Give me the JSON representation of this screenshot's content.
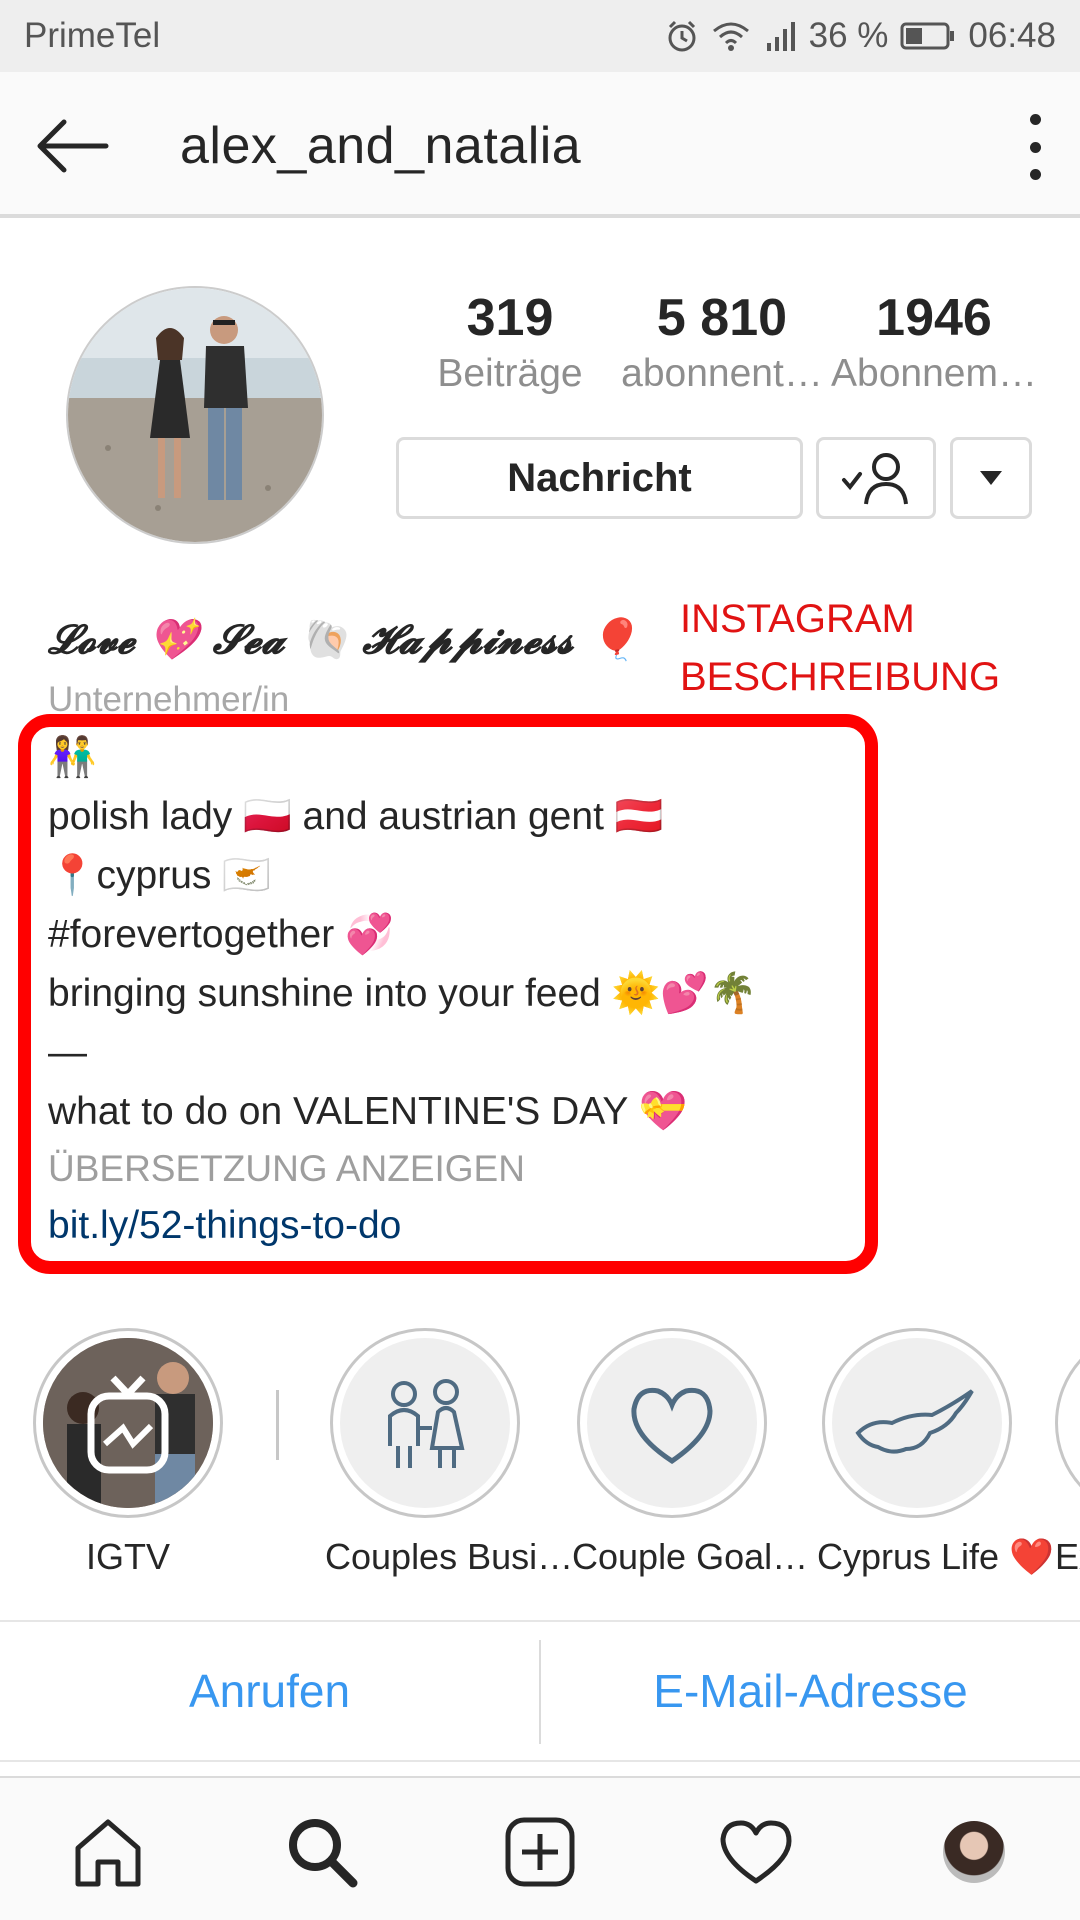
{
  "status_bar": {
    "carrier": "PrimeTel",
    "battery_text": "36 %",
    "time": "06:48",
    "icons": [
      "alarm-icon",
      "wifi-icon",
      "signal-icon",
      "battery-icon"
    ]
  },
  "top_bar": {
    "username": "alex_and_natalia",
    "back_icon": "arrow-left-icon",
    "more_icon": "more-vertical-icon"
  },
  "profile": {
    "stats": [
      {
        "value": "319",
        "label": "Beiträge"
      },
      {
        "value": "5 810",
        "label": "abonnent…"
      },
      {
        "value": "1946",
        "label": "Abonnem…"
      }
    ],
    "message_button": "Nachricht"
  },
  "bio": {
    "name": "𝓛𝓸𝓿𝓮 💖 𝓢𝓮𝓪 🐚 𝓗𝓪𝓹𝓹𝓲𝓷𝓮𝓼𝓼 🎈",
    "category": "Unternehmer/in",
    "lines": [
      "👫",
      "polish lady 🇵🇱 and austrian gent 🇦🇹",
      "📍cyprus 🇨🇾",
      "#forevertogether 💞",
      "bringing sunshine into your feed 🌞💕🌴",
      "—",
      "what to do on VALENTINE'S DAY 💝"
    ],
    "translate": "ÜBERSETZUNG ANZEIGEN",
    "link": "bit.ly/52-things-to-do"
  },
  "annotation": {
    "line1": "INSTAGRAM",
    "line2": "BESCHREIBUNG",
    "color": "#ff0000"
  },
  "highlights": [
    {
      "label": "IGTV",
      "icon": "igtv-icon"
    },
    {
      "label": "Couples Busi…",
      "icon": "couple-icon"
    },
    {
      "label": "Couple Goal…",
      "icon": "heart-outline-icon"
    },
    {
      "label": "Cyprus Life ❤️",
      "icon": "cyprus-map-icon"
    },
    {
      "label": "Ex",
      "icon": ""
    }
  ],
  "contact": {
    "call": "Anrufen",
    "email": "E-Mail-Adresse",
    "accent": "#3897f0"
  },
  "bottom_nav": [
    "home-icon",
    "search-icon",
    "add-post-icon",
    "activity-heart-icon",
    "profile-avatar"
  ]
}
